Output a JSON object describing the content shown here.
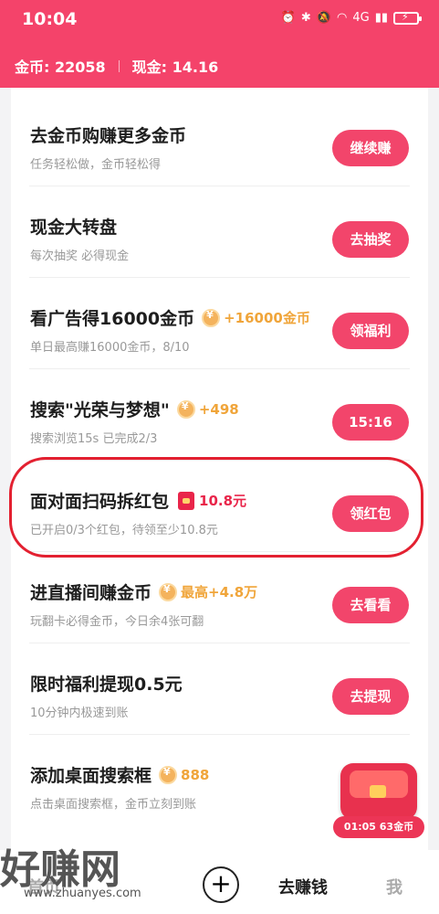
{
  "status_bar": {
    "time": "10:04",
    "network": "4G"
  },
  "wallet": {
    "coins_label": "金币: 22058",
    "cash_label": "现金: 14.16"
  },
  "tasks": [
    {
      "title": "去金币购赚更多金币",
      "reward": "",
      "subtitle": "任务轻松做，金币轻松得",
      "button": "继续赚"
    },
    {
      "title": "现金大转盘",
      "reward": "",
      "subtitle": "每次抽奖 必得现金",
      "button": "去抽奖"
    },
    {
      "title": "看广告得16000金币",
      "reward": "+16000金币",
      "subtitle": "单日最高赚16000金币，8/10",
      "button": "领福利"
    },
    {
      "title": "搜索\"光荣与梦想\"",
      "reward": "+498",
      "subtitle": "搜索浏览15s 已完成2/3",
      "button": "15:16"
    },
    {
      "title": "面对面扫码拆红包",
      "reward": "10.8元",
      "subtitle": "已开启0/3个红包，待领至少10.8元",
      "button": "领红包"
    },
    {
      "title": "进直播间赚金币",
      "reward": "最高+4.8万",
      "subtitle": "玩翻卡必得金币，今日余4张可翻",
      "button": "去看看"
    },
    {
      "title": "限时福利提现0.5元",
      "reward": "",
      "subtitle": "10分钟内极速到账",
      "button": "去提现"
    },
    {
      "title": "添加桌面搜索框",
      "reward": "888",
      "subtitle": "点击桌面搜索框，金币立刻到账",
      "button": ""
    }
  ],
  "floating_widget": {
    "text": "01:05 63金币"
  },
  "bottom_nav": {
    "home": "首页",
    "earn": "去赚钱",
    "me": "我"
  },
  "watermark": {
    "logo": "好赚网",
    "url": "www.zhuanyes.com"
  },
  "colors": {
    "brand": "#f4436a",
    "reward_gold": "#f0a53a",
    "reward_red": "#e9254a"
  }
}
